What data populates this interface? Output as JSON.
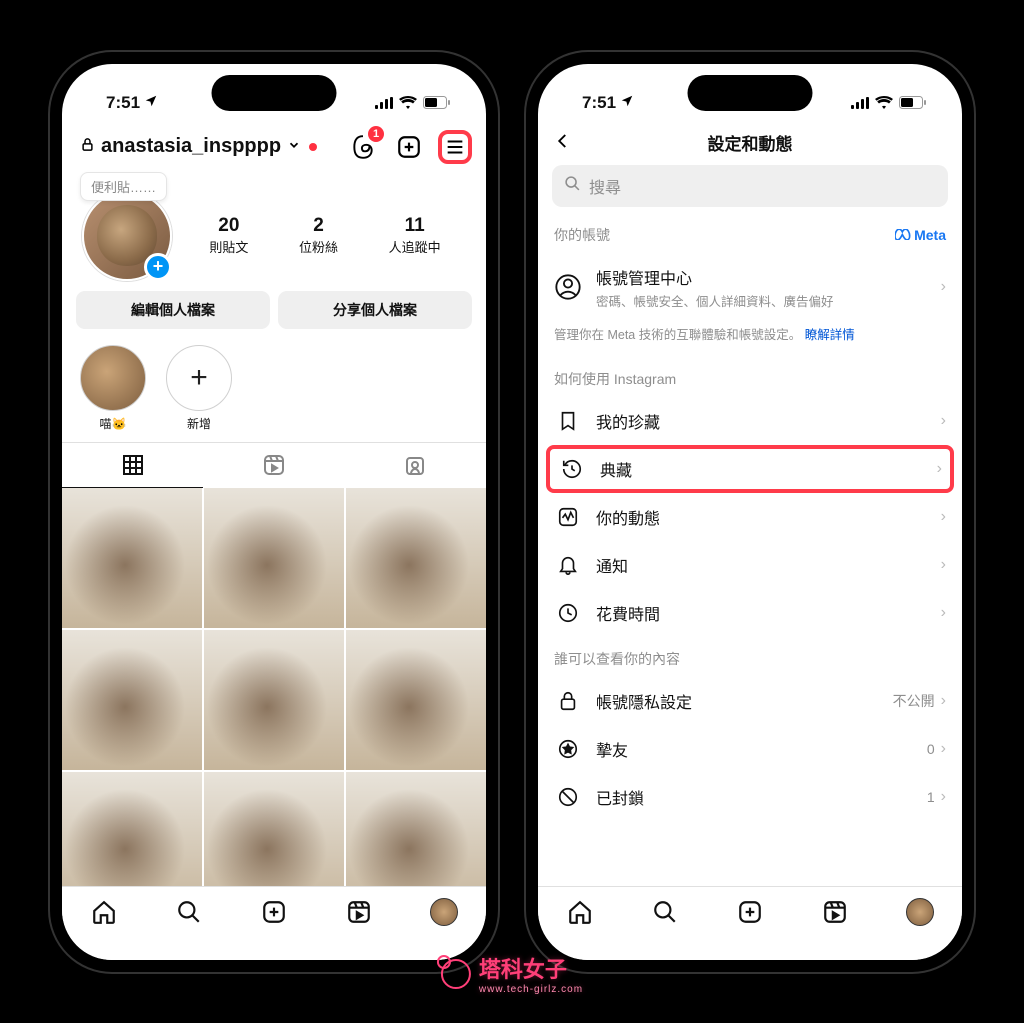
{
  "status": {
    "time": "7:51",
    "location_icon": "location-arrow"
  },
  "profile": {
    "username": "anastasia_inspppp",
    "threads_badge": "1",
    "sticky_note": "便利貼……",
    "stats": {
      "posts_num": "20",
      "posts_lbl": "則貼文",
      "followers_num": "2",
      "followers_lbl": "位粉絲",
      "following_num": "11",
      "following_lbl": "人追蹤中"
    },
    "edit_btn": "編輯個人檔案",
    "share_btn": "分享個人檔案",
    "highlights": {
      "cat_lbl": "喵🐱",
      "new_lbl": "新增"
    }
  },
  "settings": {
    "title": "設定和動態",
    "search_placeholder": "搜尋",
    "section_account": "你的帳號",
    "meta_label": "Meta",
    "account_center_title": "帳號管理中心",
    "account_center_sub": "密碼、帳號安全、個人詳細資料、廣告偏好",
    "account_center_note": "管理你在 Meta 技術的互聯體驗和帳號設定。",
    "account_center_link": "瞭解詳情",
    "section_usage": "如何使用 Instagram",
    "rows": {
      "saved": "我的珍藏",
      "archive": "典藏",
      "activity": "你的動態",
      "notifications": "通知",
      "time": "花費時間"
    },
    "section_privacy": "誰可以查看你的內容",
    "privacy_row": "帳號隱私設定",
    "privacy_state": "不公開",
    "close_friends": "摯友",
    "close_friends_count": "0",
    "blocked": "已封鎖",
    "blocked_count": "1"
  },
  "watermark": {
    "name": "塔科女子",
    "url": "www.tech-girlz.com"
  }
}
